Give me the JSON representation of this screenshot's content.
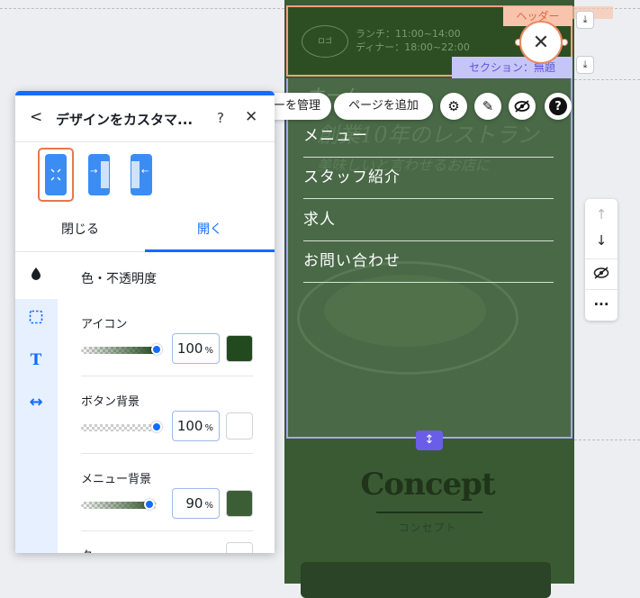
{
  "header": {
    "badge": "ヘッダー",
    "hours_line1": "ランチ：11:00~14:00",
    "hours_line2": "ディナー：18:00~22:00",
    "logo": "ロゴ"
  },
  "section_badge": "セクション：無題",
  "site_bg_text": {
    "line1": "創業10年のレストラン",
    "line2": "美味しいと言わせるお店に"
  },
  "menu": {
    "items": [
      "メニュー",
      "スタッフ紹介",
      "求人",
      "お問い合わせ"
    ]
  },
  "concept": {
    "title": "Concept",
    "subtitle": "コンセプト"
  },
  "toolbar": {
    "manage_label": "ーを管理",
    "add_page_label": "ページを追加"
  },
  "panel": {
    "title": "デザインをカスタマ...",
    "help": "?",
    "tabs": {
      "closed": "閉じる",
      "open": "開く"
    },
    "section_heading": "色・不透明度",
    "controls": [
      {
        "label": "アイコン",
        "value": "100",
        "unit": "%",
        "opacity": 1.0,
        "color": "#23491f"
      },
      {
        "label": "ボタン背景",
        "value": "100",
        "unit": "%",
        "opacity": 1.0,
        "color": "#ffffff"
      },
      {
        "label": "メニュー背景",
        "value": "90",
        "unit": "%",
        "opacity": 0.9,
        "color": "#3c5e37"
      },
      {
        "label": "ク",
        "color": "#ffffff"
      }
    ]
  },
  "colors": {
    "accent": "#116dff",
    "header_outline": "#f3a07e",
    "section_outline": "#a8a6ee"
  }
}
